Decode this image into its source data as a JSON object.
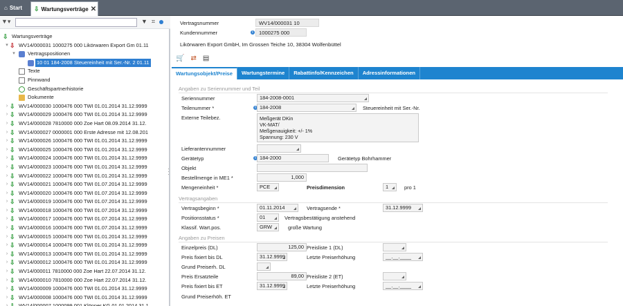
{
  "tabs": {
    "start": "Start",
    "active": "Wartungsverträge",
    "close": "✕"
  },
  "tree": {
    "root": "Wartungsverträge",
    "open_contract": "WV14/000031  1000275  000  Likörwaren Export Gm  01.11",
    "positions": "Vertragspositionen",
    "selected_position": "10  01  184-2008  Steuereinheit mit Ser.-Nr.  2  01.11",
    "children": [
      "Texte",
      "Pinnwand",
      "Geschäftspartnerhistorie",
      "Dokumente"
    ],
    "contracts": [
      "WV14/000030  1000476  000  TWI  01.01.2014  31.12.9999",
      "WV14/000029  1000476  000  TWI  01.01.2014  31.12.9999",
      "WV14/000028  7810000  000  Zoe Hart  08.09.2014  31.12.",
      "WV14/000027  0000001  000  Erste Adresse mit  12.08.201",
      "WV14/000026  1000476  000  TWI  01.01.2014  31.12.9999",
      "WV14/000025  1000476  000  TWI  01.01.2014  31.12.9999",
      "WV14/000024  1000476  000  TWI  01.01.2014  31.12.9999",
      "WV14/000023  1000476  000  TWI  01.01.2014  31.12.9999",
      "WV14/000022  1000476  000  TWI  01.01.2014  31.12.9999",
      "WV14/000021  1000476  000  TWI  01.07.2014  31.12.9999",
      "WV14/000020  1000476  000  TWI  01.07.2014  31.12.9999",
      "WV14/000019  1000476  000  TWI  01.07.2014  31.12.9999",
      "WV14/000018  1000476  000  TWI  01.07.2014  31.12.9999",
      "WV14/000017  1000476  000  TWI  01.07.2014  31.12.9999",
      "WV14/000016  1000476  000  TWI  01.07.2014  31.12.9999",
      "WV14/000015  1000476  000  TWI  01.01.2014  31.12.9999",
      "WV14/000014  1000476  000  TWI  01.01.2014  31.12.9999",
      "WV14/000013  1000476  000  TWI  01.01.2014  31.12.9999",
      "WV14/000012  1000476  000  TWI  01.01.2014  31.12.9999",
      "WV14/000011  7810000  000  Zoe Hart  22.07.2014  31.12.",
      "WV14/000010  7810000  000  Zoe Hart  22.07.2014  31.12.",
      "WV14/000009  1000476  000  TWI  01.01.2014  31.12.9999",
      "WV14/000008  1000476  000  TWI  01.01.2014  31.12.9999",
      "WV14/000007  1000099  001  Klöpper KG  01.01.2014  31.1"
    ]
  },
  "header": {
    "contract_label": "Vertragsnummer",
    "contract_value": "WV14/000031 10",
    "customer_label": "Kundennummer",
    "customer_value": "1000275 000",
    "address": "Likörwaren Export GmbH, Im Grossen Teiche 10, 38304 Wolfenbüttel"
  },
  "detail_tabs": [
    "Wartungsobjekt/Preise",
    "Wartungstermine",
    "Rabattinfo/Kennzeichen",
    "Adressinformationen"
  ],
  "sections": {
    "serial": "Angaben zu Seriennummer und Teil",
    "contract": "Vertragsangaben",
    "prices": "Angaben zu Preisen"
  },
  "fields": {
    "serial_label": "Seriennummer",
    "serial_value": "184-2008-0001",
    "part_label": "Teilenummer *",
    "part_value": "184-2008",
    "part_desc": "Steuereinheit mit Ser.-Nr.",
    "ext_label": "Externe Teilebez.",
    "ext_value": "Meßgerät DKin\nVK-MAT/\nMeßgenauigkeit: +/- 1%\nSpannung: 230 V",
    "supplier_label": "Lieferantennummer",
    "supplier_value": "",
    "devtype_label": "Gerätetyp",
    "devtype_value": "184-2000",
    "devtype_desc": "Gerätetyp Bohrhammer",
    "object_label": "Objekt",
    "object_value": "",
    "qty_label": "Bestellmenge in ME1 *",
    "qty_value": "1,000",
    "unit_label": "Mengeneinheit *",
    "unit_value": "PCE",
    "pricedim_label": "Preisdimension",
    "pricedim_value": "1",
    "pricedim_desc": "pro 1",
    "start_label": "Vertragsbeginn *",
    "start_value": "01.11.2014",
    "end_label": "Vertragsende *",
    "end_value": "31.12.9999",
    "posstatus_label": "Positionsstatus *",
    "posstatus_value": "01",
    "posstatus_desc": "Vertragsbestätigung anstehend",
    "class_label": "Klassif. Wart.pos.",
    "class_value": "GRW",
    "class_desc": "große Wartung",
    "unitprice_label": "Einzelpreis (DL)",
    "unitprice_value": "125,00",
    "pl1_label": "Preisliste 1 (DL)",
    "pl1_value": "",
    "fixdl_label": "Preis fixiert bis DL",
    "fixdl_value": "31.12.9999",
    "lastinc1_label": "Letzte Preiserhöhung",
    "lastinc1_value": "__.__.____",
    "basepricedl_label": "Grund Preiserh. DL",
    "basepricedl_value": "",
    "spare_label": "Preis Ersatzteile",
    "spare_value": "89,00",
    "pl2_label": "Preisliste 2 (ET)",
    "pl2_value": "",
    "fixet_label": "Preis fixiert bis ET",
    "fixet_value": "31.12.9999",
    "lastinc2_label": "Letzte Preiserhöhung",
    "lastinc2_value": "__.__.____",
    "basepriceet_label": "Grund Preiserhöh. ET"
  },
  "colors": {
    "accent": "#1e84cf",
    "selection": "#2f7fd1",
    "topbar": "#5b6470"
  }
}
